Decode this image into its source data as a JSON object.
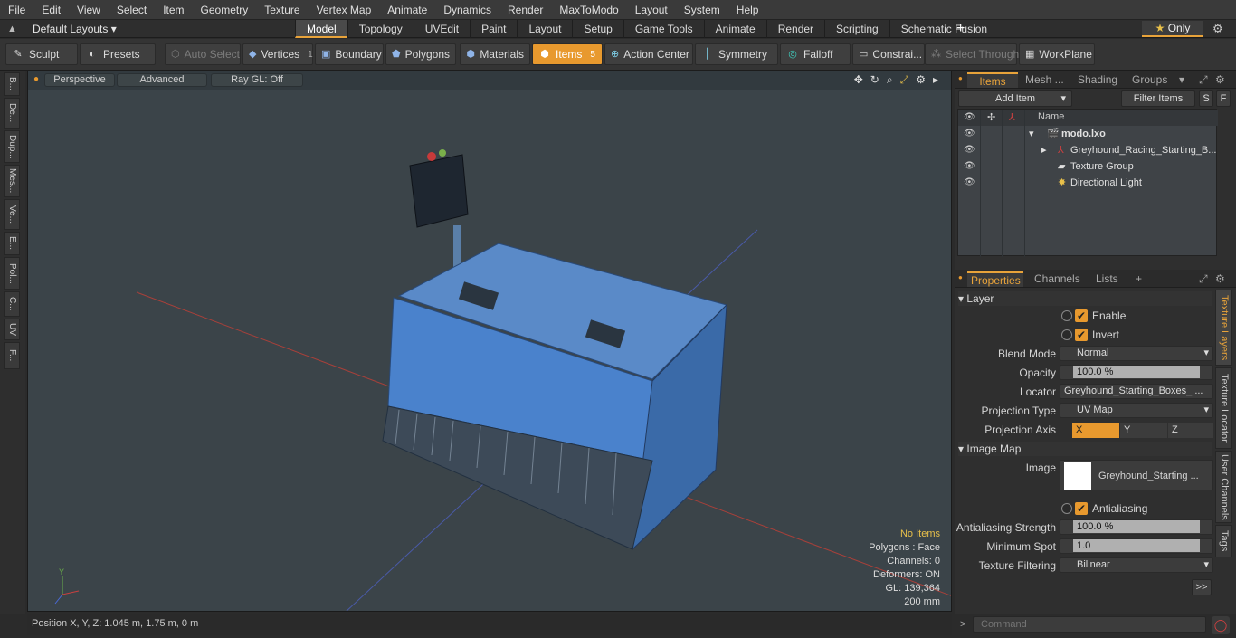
{
  "menu": [
    "File",
    "Edit",
    "View",
    "Select",
    "Item",
    "Geometry",
    "Texture",
    "Vertex Map",
    "Animate",
    "Dynamics",
    "Render",
    "MaxToModo",
    "Layout",
    "System",
    "Help"
  ],
  "layouts_label": "Default Layouts ▾",
  "tabs": [
    "Model",
    "Topology",
    "UVEdit",
    "Paint",
    "Layout",
    "Setup",
    "Game Tools",
    "Animate",
    "Render",
    "Scripting",
    "Schematic Fusion"
  ],
  "active_tab": "Model",
  "only_label": "Only",
  "toolbar": {
    "sculpt": "Sculpt",
    "presets": "Presets",
    "auto_select": "Auto Select",
    "vertices": "Vertices",
    "vertices_count": "1",
    "boundary": "Boundary",
    "polygons": "Polygons",
    "materials": "Materials",
    "items": "Items",
    "items_count": "5",
    "action_center": "Action Center",
    "symmetry": "Symmetry",
    "falloff": "Falloff",
    "constraints": "Constrai...",
    "select_through": "Select Through",
    "workplane": "WorkPlane"
  },
  "left_tabs": [
    "B...",
    "De...",
    "Dup...",
    "Mes...",
    "Ve...",
    "E...",
    "Pol...",
    "C...",
    "UV",
    "F..."
  ],
  "viewport": {
    "perspective": "Perspective",
    "advanced": "Advanced",
    "raygl": "Ray GL: Off",
    "stats": {
      "no_items": "No Items",
      "polygons": "Polygons : Face",
      "channels": "Channels: 0",
      "deformers": "Deformers: ON",
      "gl": "GL: 139,364",
      "scale": "200 mm"
    }
  },
  "status": {
    "position": "Position X, Y, Z:   1.045 m, 1.75 m, 0 m"
  },
  "items_panel": {
    "tabs": [
      "Items",
      "Mesh ...",
      "Shading",
      "Groups"
    ],
    "add_item": "Add Item",
    "filter_items": "Filter Items",
    "s_btn": "S",
    "f_btn": "F",
    "col_name": "Name",
    "rows": [
      {
        "name": "modo.lxo"
      },
      {
        "name": "Greyhound_Racing_Starting_B..."
      },
      {
        "name": "Texture Group"
      },
      {
        "name": "Directional Light"
      }
    ]
  },
  "properties": {
    "tabs": [
      "Properties",
      "Channels",
      "Lists"
    ],
    "layer_section": "Layer",
    "enable": "Enable",
    "invert": "Invert",
    "blend_mode_label": "Blend Mode",
    "blend_mode": "Normal",
    "opacity_label": "Opacity",
    "opacity": "100.0 %",
    "locator_label": "Locator",
    "locator": "Greyhound_Starting_Boxes_ ...",
    "projection_type_label": "Projection Type",
    "projection_type": "UV Map",
    "projection_axis_label": "Projection Axis",
    "axis_x": "X",
    "axis_y": "Y",
    "axis_z": "Z",
    "image_map_section": "Image Map",
    "image_label": "Image",
    "image": "Greyhound_Starting ...",
    "antialiasing": "Antialiasing",
    "aa_strength_label": "Antialiasing Strength",
    "aa_strength": "100.0 %",
    "min_spot_label": "Minimum Spot",
    "min_spot": "1.0",
    "tex_filter_label": "Texture Filtering",
    "tex_filter": "Bilinear",
    "more": ">>"
  },
  "vertical_tabs": [
    "Texture Layers",
    "Texture Locator",
    "User Channels",
    "Tags"
  ],
  "command_placeholder": "Command",
  "colors": {
    "accent": "#e8992e",
    "viewport_bg": "#3b4449",
    "box_blue": "#3f78c0"
  }
}
